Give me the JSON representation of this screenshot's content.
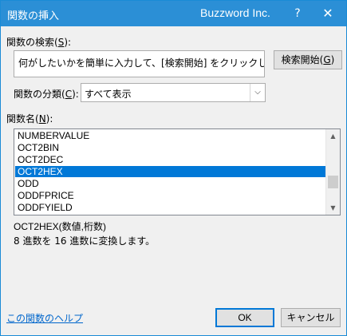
{
  "window": {
    "title": "関数の挿入",
    "brand": "Buzzword Inc.",
    "help_label": "?",
    "close_label": "✕"
  },
  "search": {
    "label_prefix": "関数の検索(",
    "label_key": "S",
    "label_suffix": "):",
    "value": "何がしたいかを簡単に入力して、[検索開始] をクリックしてください。",
    "button_prefix": "検索開始(",
    "button_key": "G",
    "button_suffix": ")"
  },
  "category": {
    "label_prefix": "関数の分類(",
    "label_key": "C",
    "label_suffix": "):",
    "selected": "すべて表示"
  },
  "functions": {
    "label_prefix": "関数名(",
    "label_key": "N",
    "label_suffix": "):",
    "items": [
      "NUMBERVALUE",
      "OCT2BIN",
      "OCT2DEC",
      "OCT2HEX",
      "ODD",
      "ODDFPRICE",
      "ODDFYIELD"
    ],
    "selected_index": 3
  },
  "details": {
    "syntax": "OCT2HEX(数値,桁数)",
    "description": "8 進数を 16 進数に変換します。"
  },
  "footer": {
    "help_link": "この関数のヘルプ",
    "ok_label": "OK",
    "cancel_label": "キャンセル"
  }
}
